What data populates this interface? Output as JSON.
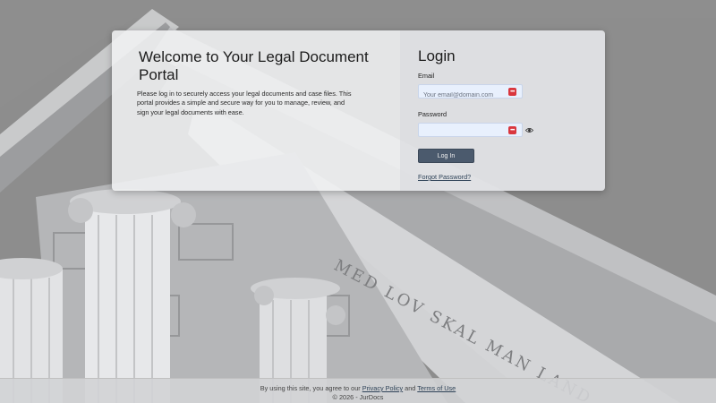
{
  "colors": {
    "primary_button": "#4b5a6d",
    "link": "#2f4358",
    "input_bg": "#e8f0fd",
    "password_manager_icon": "#d9363e"
  },
  "welcome": {
    "title": "Welcome to Your Legal Document Portal",
    "text": "Please log in to securely access your legal documents and case files. This portal provides a simple and secure way for you to manage, review, and sign your legal documents with ease."
  },
  "login": {
    "title": "Login",
    "email_label": "Email",
    "email_placeholder": "Your email@domain.com",
    "email_value": "",
    "password_label": "Password",
    "password_value": "",
    "button_label": "Log In",
    "forgot_link": "Forgot Password?",
    "icons": [
      "password-manager-icon",
      "eye-icon"
    ]
  },
  "background": {
    "inscription": "MED LOV SKAL MAN LAND"
  },
  "footer": {
    "prefix": "By using this site, you agree to our",
    "privacy_link": "Privacy Policy",
    "conjunction": "and",
    "terms_link": "Terms of Use",
    "copyright": "© 2026 - JurDocs"
  }
}
